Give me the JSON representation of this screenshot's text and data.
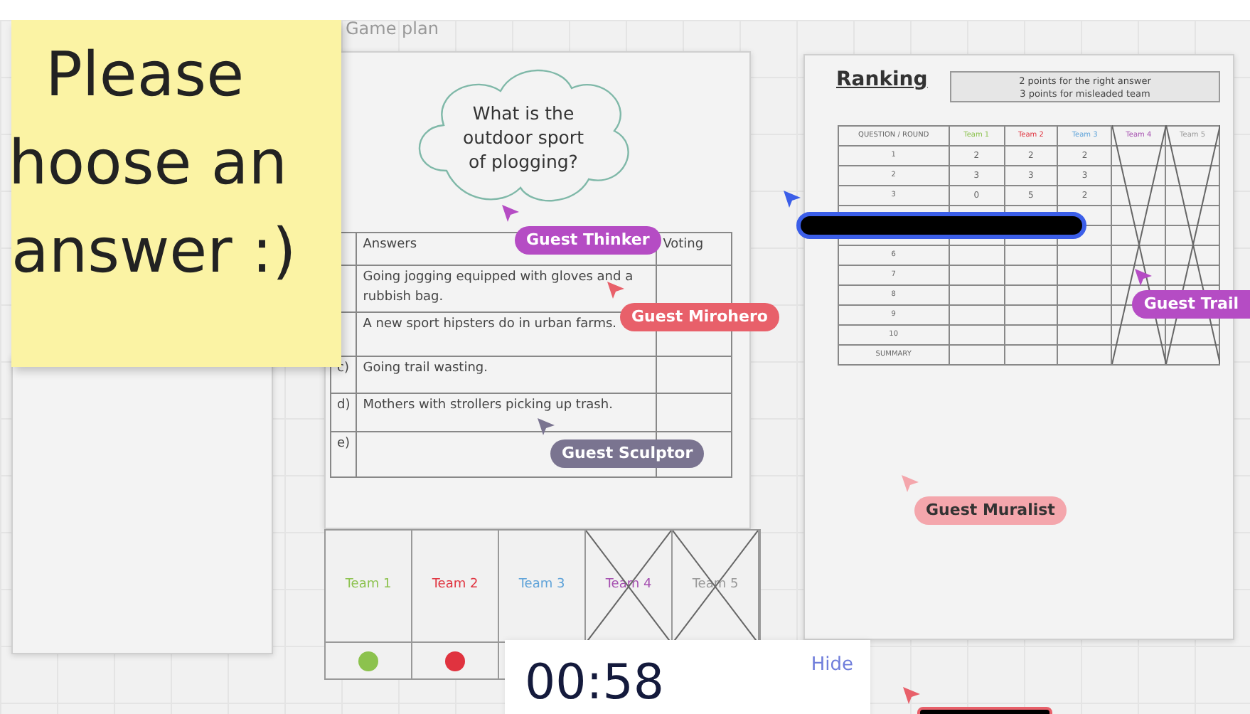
{
  "frame_title": "Game plan",
  "sticky_note": {
    "lines": [
      "Please",
      "hoose an",
      "answer :)"
    ]
  },
  "question": "What is the outdoor sport of plogging?",
  "answers_table": {
    "columns": [
      "Answers",
      "Voting"
    ],
    "rows": [
      {
        "text": "Going jogging equipped with gloves and a rubbish bag."
      },
      {
        "text": "A new sport hipsters do in urban farms."
      },
      {
        "letter": "c)",
        "text": "Going trail wasting."
      },
      {
        "letter": "d)",
        "text": "Mothers with strollers picking up trash."
      },
      {
        "letter": "e)"
      }
    ]
  },
  "teams": [
    {
      "name": "Team 1",
      "color": "#8cc24e",
      "crossed": false,
      "dot_visible": true
    },
    {
      "name": "Team 2",
      "color": "#e0333f",
      "crossed": false,
      "dot_visible": true
    },
    {
      "name": "Team 3",
      "color": "#5fa3d9",
      "crossed": false,
      "dot_visible": false
    },
    {
      "name": "Team 4",
      "color": "#a54fb0",
      "crossed": true,
      "dot_visible": false
    },
    {
      "name": "Team 5",
      "color": "#999999",
      "crossed": true,
      "dot_visible": false
    }
  ],
  "ranking": {
    "title": "Ranking",
    "note": [
      "2 points for the right answer",
      "3 points for misleaded team"
    ],
    "columns": [
      "QUESTION / ROUND",
      "Team 1",
      "Team 2",
      "Team 3",
      "Team 4",
      "Team 5"
    ],
    "rows": [
      {
        "label": "1",
        "values": [
          "2",
          "2",
          "2"
        ]
      },
      {
        "label": "2",
        "values": [
          "3",
          "3",
          "3"
        ]
      },
      {
        "label": "3",
        "values": [
          "0",
          "5",
          "2"
        ]
      },
      {
        "values": []
      },
      {
        "values": []
      },
      {
        "label": "6",
        "values": []
      },
      {
        "label": "7",
        "values": []
      },
      {
        "label": "8",
        "values": []
      },
      {
        "label": "9",
        "values": []
      },
      {
        "label": "10",
        "values": []
      },
      {
        "label": "SUMMARY",
        "values": []
      }
    ]
  },
  "cursors": [
    {
      "name": "Guest Thinker",
      "color": "#b54cc4"
    },
    {
      "name": "Guest Mirohero",
      "color": "#e8606a"
    },
    {
      "name": "Guest Sculptor",
      "color": "#7a7490"
    },
    {
      "name": "Guest Trail",
      "color": "#b54cc4"
    },
    {
      "name": "Guest Muralist",
      "color": "#f4a6ac"
    },
    {
      "color": "#3b5ee8"
    },
    {
      "color": "#e8606a"
    }
  ],
  "timer": {
    "time": "00:58",
    "hide_label": "Hide"
  }
}
